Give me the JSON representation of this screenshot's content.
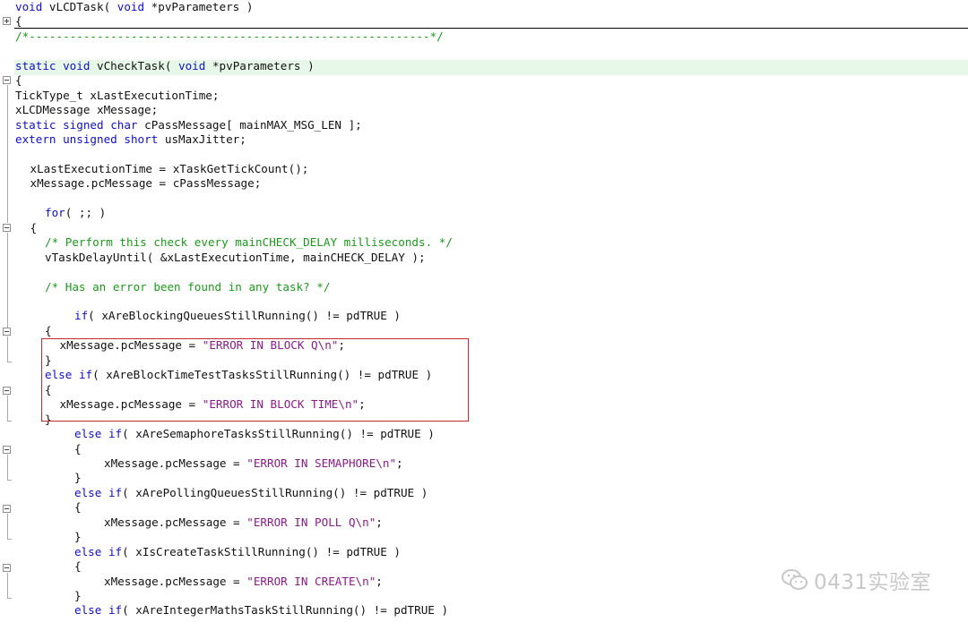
{
  "editor": {
    "lines": [
      {
        "indent": 0,
        "tokens": [
          [
            "kw",
            "void"
          ],
          [
            "t",
            " vLCDTask( "
          ],
          [
            "kw",
            "void"
          ],
          [
            "t",
            " *pvParameters )"
          ]
        ]
      },
      {
        "indent": 0,
        "tokens": [
          [
            "t",
            "{"
          ]
        ]
      },
      {
        "indent": 0,
        "tokens": [
          [
            "cm",
            "/*-----------------------------------------------------------*/"
          ]
        ]
      },
      {
        "indent": 0,
        "tokens": []
      },
      {
        "indent": 0,
        "tokens": [
          [
            "kw",
            "static"
          ],
          [
            "t",
            " "
          ],
          [
            "kw",
            "void"
          ],
          [
            "t",
            " vCheckTask( "
          ],
          [
            "kw",
            "void"
          ],
          [
            "t",
            " *pvParameters )"
          ]
        ]
      },
      {
        "indent": 0,
        "tokens": [
          [
            "t",
            "{"
          ]
        ]
      },
      {
        "indent": 0,
        "tokens": [
          [
            "t",
            "TickType_t xLastExecutionTime;"
          ]
        ]
      },
      {
        "indent": 0,
        "tokens": [
          [
            "t",
            "xLCDMessage xMessage;"
          ]
        ]
      },
      {
        "indent": 0,
        "tokens": [
          [
            "kw",
            "static"
          ],
          [
            "t",
            " "
          ],
          [
            "kw",
            "signed"
          ],
          [
            "t",
            " "
          ],
          [
            "kw",
            "char"
          ],
          [
            "t",
            " cPassMessage[ mainMAX_MSG_LEN ];"
          ]
        ]
      },
      {
        "indent": 0,
        "tokens": [
          [
            "kw",
            "extern"
          ],
          [
            "t",
            " "
          ],
          [
            "kw",
            "unsigned"
          ],
          [
            "t",
            " "
          ],
          [
            "kw",
            "short"
          ],
          [
            "t",
            " usMaxJitter;"
          ]
        ]
      },
      {
        "indent": 0,
        "tokens": []
      },
      {
        "indent": 1,
        "tokens": [
          [
            "t",
            "xLastExecutionTime = xTaskGetTickCount();"
          ]
        ]
      },
      {
        "indent": 1,
        "tokens": [
          [
            "t",
            "xMessage.pcMessage = cPassMessage;"
          ]
        ]
      },
      {
        "indent": 0,
        "tokens": []
      },
      {
        "indent": 2,
        "tokens": [
          [
            "kw",
            "for"
          ],
          [
            "t",
            "( ;; )"
          ]
        ]
      },
      {
        "indent": 1,
        "tokens": [
          [
            "t",
            "{"
          ]
        ]
      },
      {
        "indent": 2,
        "tokens": [
          [
            "cm",
            "/* Perform this check every mainCHECK_DELAY milliseconds. */"
          ]
        ]
      },
      {
        "indent": 2,
        "tokens": [
          [
            "t",
            "vTaskDelayUntil( &xLastExecutionTime, mainCHECK_DELAY );"
          ]
        ]
      },
      {
        "indent": 0,
        "tokens": []
      },
      {
        "indent": 2,
        "tokens": [
          [
            "cm",
            "/* Has an error been found in any task? */"
          ]
        ]
      },
      {
        "indent": 0,
        "tokens": []
      },
      {
        "indent": 4,
        "tokens": [
          [
            "kw",
            "if"
          ],
          [
            "t",
            "( xAreBlockingQueuesStillRunning() != pdTRUE )"
          ]
        ]
      },
      {
        "indent": 2,
        "tokens": [
          [
            "t",
            "{"
          ]
        ]
      },
      {
        "indent": 3,
        "tokens": [
          [
            "t",
            "xMessage.pcMessage = "
          ],
          [
            "st",
            "\"ERROR IN BLOCK Q\\n\""
          ],
          [
            "t",
            ";"
          ]
        ]
      },
      {
        "indent": 2,
        "tokens": [
          [
            "t",
            "}"
          ]
        ]
      },
      {
        "indent": 2,
        "tokens": [
          [
            "kw",
            "else"
          ],
          [
            "t",
            " "
          ],
          [
            "kw",
            "if"
          ],
          [
            "t",
            "( xAreBlockTimeTestTasksStillRunning() != pdTRUE )"
          ]
        ]
      },
      {
        "indent": 2,
        "tokens": [
          [
            "t",
            "{"
          ]
        ]
      },
      {
        "indent": 3,
        "tokens": [
          [
            "t",
            "xMessage.pcMessage = "
          ],
          [
            "st",
            "\"ERROR IN BLOCK TIME\\n\""
          ],
          [
            "t",
            ";"
          ]
        ]
      },
      {
        "indent": 2,
        "tokens": [
          [
            "t",
            "}"
          ]
        ]
      },
      {
        "indent": 4,
        "tokens": [
          [
            "kw",
            "else"
          ],
          [
            "t",
            " "
          ],
          [
            "kw",
            "if"
          ],
          [
            "t",
            "( xAreSemaphoreTasksStillRunning() != pdTRUE )"
          ]
        ]
      },
      {
        "indent": 4,
        "tokens": [
          [
            "t",
            "{"
          ]
        ]
      },
      {
        "indent": 6,
        "tokens": [
          [
            "t",
            "xMessage.pcMessage = "
          ],
          [
            "st",
            "\"ERROR IN SEMAPHORE\\n\""
          ],
          [
            "t",
            ";"
          ]
        ]
      },
      {
        "indent": 4,
        "tokens": [
          [
            "t",
            "}"
          ]
        ]
      },
      {
        "indent": 4,
        "tokens": [
          [
            "kw",
            "else"
          ],
          [
            "t",
            " "
          ],
          [
            "kw",
            "if"
          ],
          [
            "t",
            "( xArePollingQueuesStillRunning() != pdTRUE )"
          ]
        ]
      },
      {
        "indent": 4,
        "tokens": [
          [
            "t",
            "{"
          ]
        ]
      },
      {
        "indent": 6,
        "tokens": [
          [
            "t",
            "xMessage.pcMessage = "
          ],
          [
            "st",
            "\"ERROR IN POLL Q\\n\""
          ],
          [
            "t",
            ";"
          ]
        ]
      },
      {
        "indent": 4,
        "tokens": [
          [
            "t",
            "}"
          ]
        ]
      },
      {
        "indent": 4,
        "tokens": [
          [
            "kw",
            "else"
          ],
          [
            "t",
            " "
          ],
          [
            "kw",
            "if"
          ],
          [
            "t",
            "( xIsCreateTaskStillRunning() != pdTRUE )"
          ]
        ]
      },
      {
        "indent": 4,
        "tokens": [
          [
            "t",
            "{"
          ]
        ]
      },
      {
        "indent": 6,
        "tokens": [
          [
            "t",
            "xMessage.pcMessage = "
          ],
          [
            "st",
            "\"ERROR IN CREATE\\n\""
          ],
          [
            "t",
            ";"
          ]
        ]
      },
      {
        "indent": 4,
        "tokens": [
          [
            "t",
            "}"
          ]
        ]
      },
      {
        "indent": 4,
        "tokens": [
          [
            "kw",
            "else"
          ],
          [
            "t",
            " "
          ],
          [
            "kw",
            "if"
          ],
          [
            "t",
            "( xAreIntegerMathsTaskStillRunning() != pdTRUE )"
          ]
        ]
      }
    ]
  },
  "watermark": {
    "text": "0431实验室",
    "icon": "wechat-icon"
  },
  "colors": {
    "keyword": "#1010c8",
    "comment": "#1b9a1b",
    "string": "#8b1a8b",
    "highlight": "#e8f8e8",
    "box": "#c62828"
  }
}
